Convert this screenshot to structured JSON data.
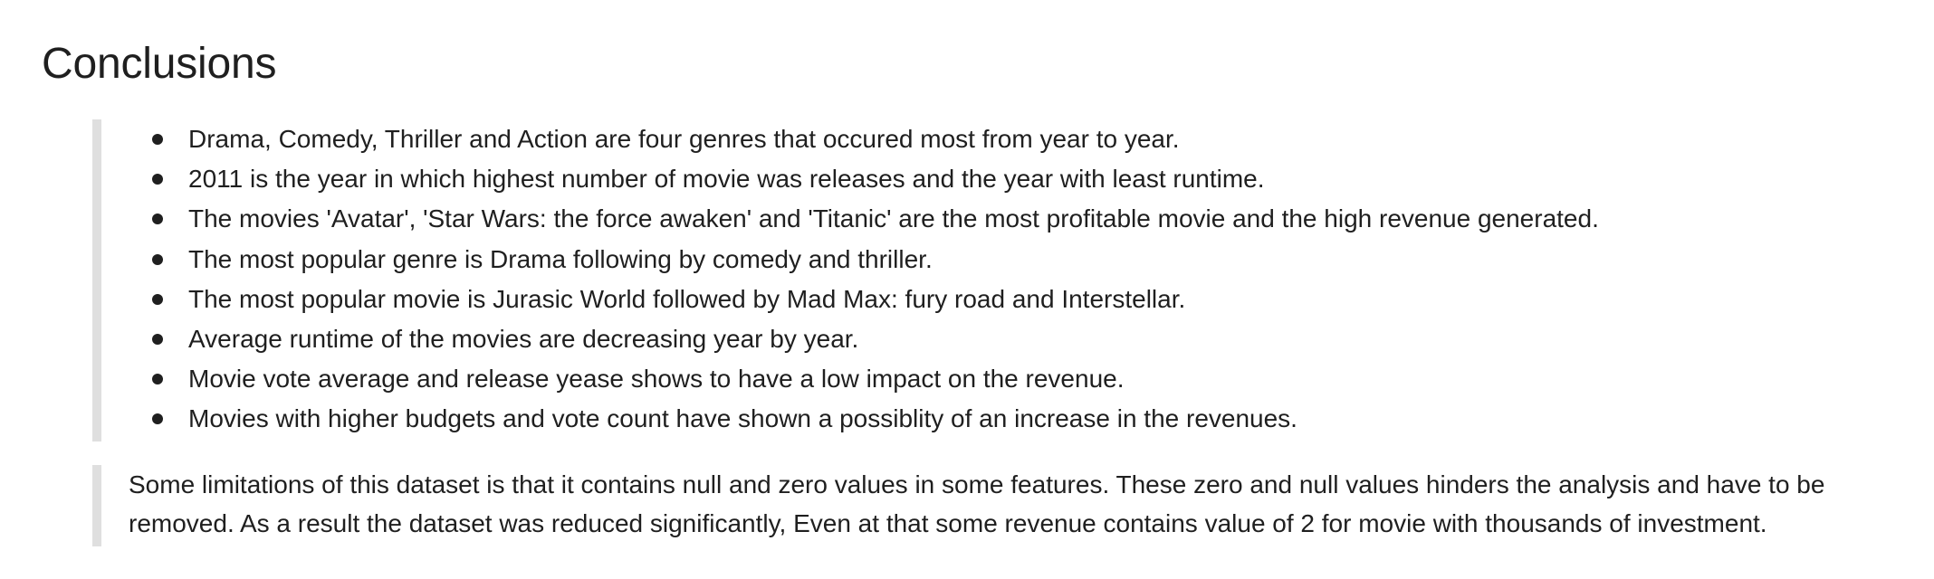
{
  "heading": "Conclusions",
  "bullets": [
    "Drama, Comedy, Thriller and Action are four genres that occured most from year to year.",
    "2011 is the year in which highest number of movie was releases and the year with least runtime.",
    "The movies 'Avatar', 'Star Wars: the force awaken' and 'Titanic' are the most profitable movie and the high revenue generated.",
    "The most popular genre is Drama following by comedy and thriller.",
    "The most popular movie is Jurasic World followed by Mad Max: fury road and Interstellar.",
    "Average runtime of the movies are decreasing year by year.",
    "Movie vote average and release yease shows to have a low impact on the revenue.",
    "Movies with higher budgets and vote count have shown a possiblity of an increase in the revenues."
  ],
  "limitations": "Some limitations of this dataset is that it contains null and zero values in some features. These zero and null values hinders the analysis and have to be removed. As a result the dataset was reduced significantly, Even at that some revenue contains value of 2 for movie with thousands of investment."
}
